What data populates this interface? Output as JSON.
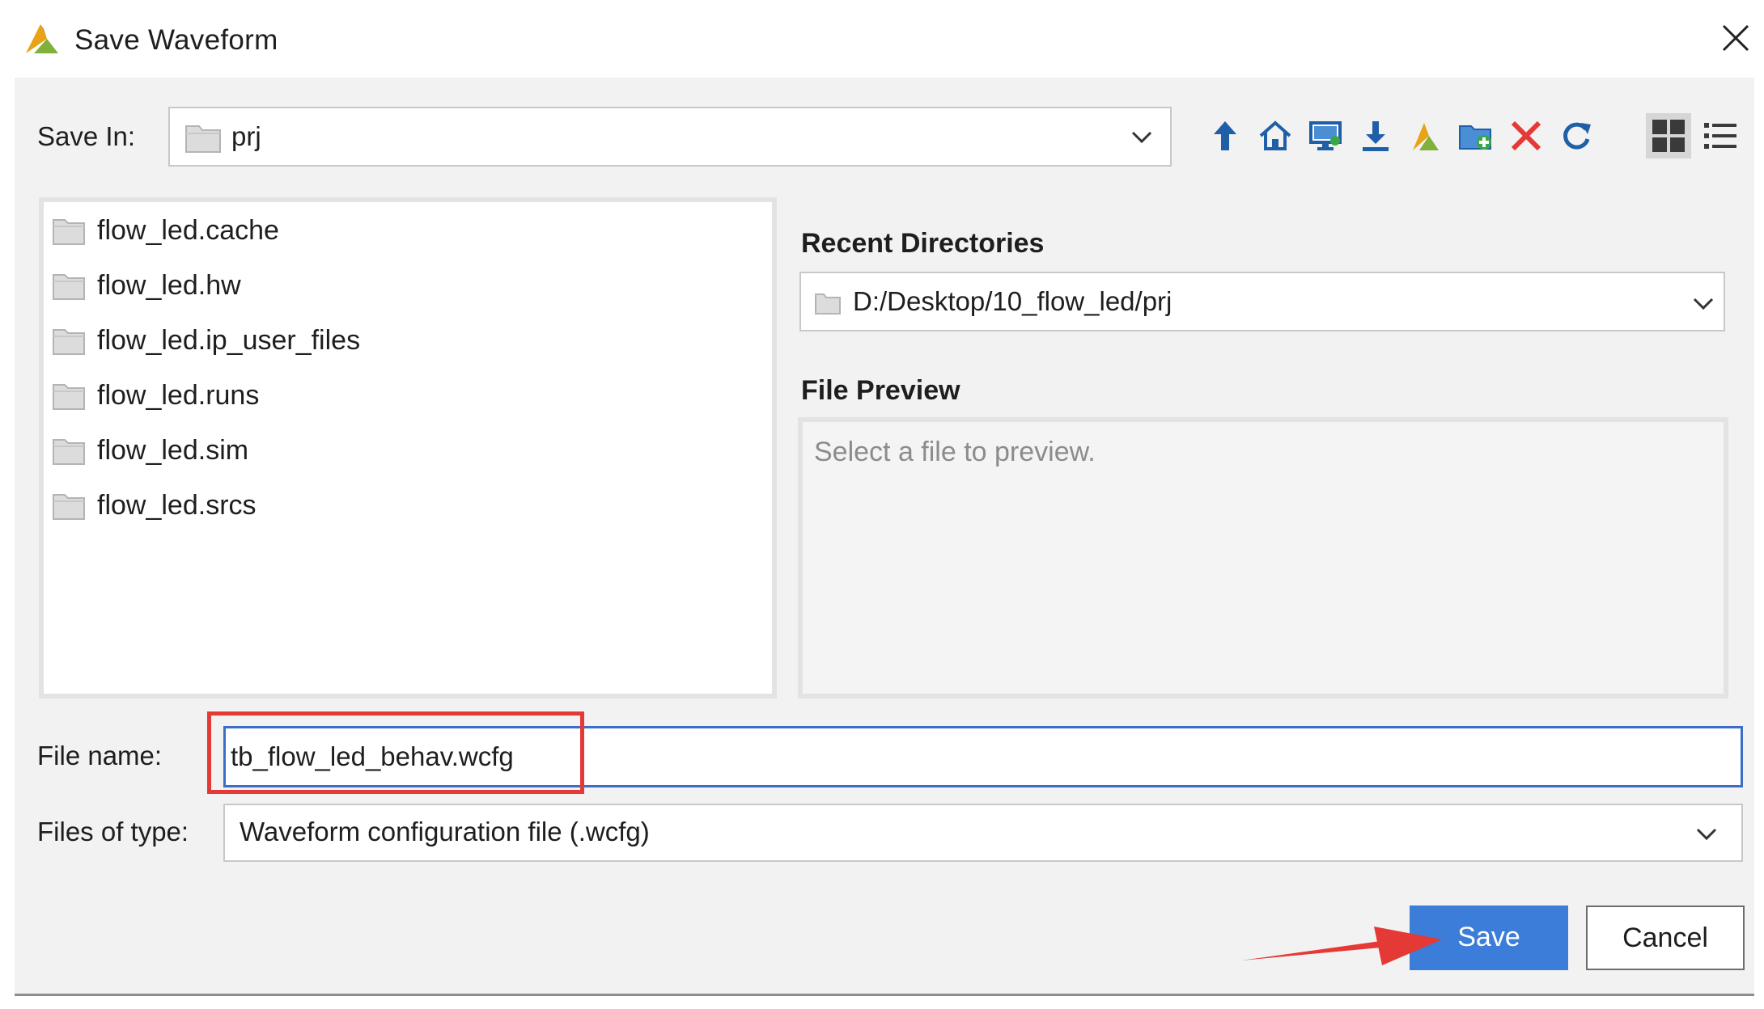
{
  "window": {
    "title": "Save Waveform"
  },
  "save_in": {
    "label": "Save In:",
    "value": "prj"
  },
  "toolbar": {
    "icons": [
      "up-folder-icon",
      "home-icon",
      "desktop-icon",
      "download-icon",
      "project-icon",
      "new-folder-icon",
      "delete-icon",
      "refresh-icon",
      "grid-view-icon",
      "list-view-icon"
    ]
  },
  "files": [
    {
      "name": "flow_led.cache"
    },
    {
      "name": "flow_led.hw"
    },
    {
      "name": "flow_led.ip_user_files"
    },
    {
      "name": "flow_led.runs"
    },
    {
      "name": "flow_led.sim"
    },
    {
      "name": "flow_led.srcs"
    }
  ],
  "recent": {
    "title": "Recent Directories",
    "value": "D:/Desktop/10_flow_led/prj"
  },
  "preview": {
    "title": "File Preview",
    "placeholder": "Select a file to preview."
  },
  "file_name": {
    "label": "File name:",
    "value": "tb_flow_led_behav.wcfg"
  },
  "file_type": {
    "label": "Files of type:",
    "value": "Waveform configuration file (.wcfg)"
  },
  "buttons": {
    "save": "Save",
    "cancel": "Cancel"
  },
  "colors": {
    "accent": "#3b7dd8",
    "highlight": "#e53935",
    "delete": "#e53935",
    "toolbar_blue": "#1f5fa8"
  }
}
